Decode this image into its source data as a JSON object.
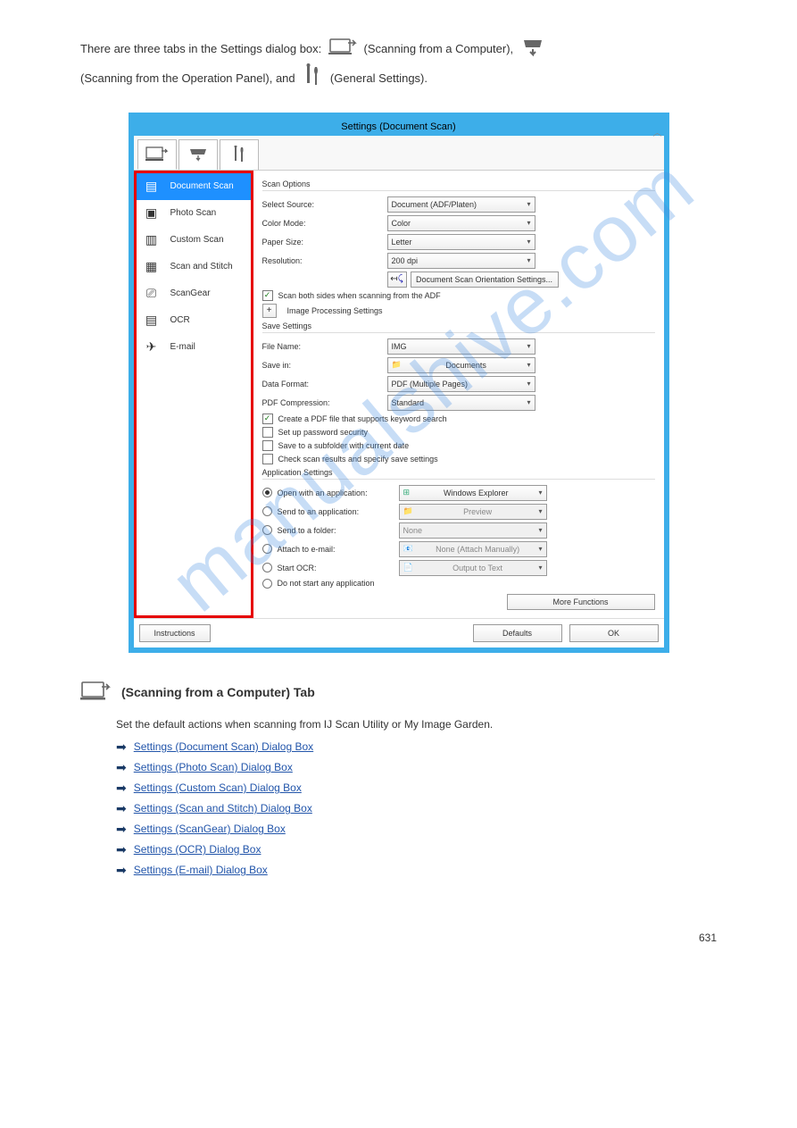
{
  "intro": {
    "line1_a": "There are three tabs in the Settings dialog box:",
    "line1_b": "(Scanning from a Computer),",
    "line1_c": "(Scanning from the Operation Panel), and",
    "line1_d": "(General Settings)."
  },
  "dialog": {
    "title": "Settings (Document Scan)"
  },
  "sidebar": {
    "items": [
      {
        "label": "Document Scan"
      },
      {
        "label": "Photo Scan"
      },
      {
        "label": "Custom Scan"
      },
      {
        "label": "Scan and Stitch"
      },
      {
        "label": "ScanGear"
      },
      {
        "label": "OCR"
      },
      {
        "label": "E-mail"
      }
    ]
  },
  "scan_options": {
    "title": "Scan Options",
    "source_label": "Select Source:",
    "source_value": "Document (ADF/Platen)",
    "color_label": "Color Mode:",
    "color_value": "Color",
    "paper_label": "Paper Size:",
    "paper_value": "Letter",
    "res_label": "Resolution:",
    "res_value": "200 dpi",
    "orient_button": "Document Scan Orientation Settings...",
    "both_sides": "Scan both sides when scanning from the ADF",
    "img_proc": "Image Processing Settings"
  },
  "save_settings": {
    "title": "Save Settings",
    "filename_label": "File Name:",
    "filename_value": "IMG",
    "savein_label": "Save in:",
    "savein_value": "Documents",
    "format_label": "Data Format:",
    "format_value": "PDF (Multiple Pages)",
    "comp_label": "PDF Compression:",
    "comp_value": "Standard",
    "keyword_search": "Create a PDF file that supports keyword search",
    "password": "Set up password security",
    "subfolder": "Save to a subfolder with current date",
    "check_results": "Check scan results and specify save settings"
  },
  "app_settings": {
    "title": "Application Settings",
    "open_label": "Open with an application:",
    "open_value": "Windows Explorer",
    "send_app_label": "Send to an application:",
    "send_app_value": "Preview",
    "send_folder_label": "Send to a folder:",
    "send_folder_value": "None",
    "attach_label": "Attach to e-mail:",
    "attach_value": "None (Attach Manually)",
    "ocr_label": "Start OCR:",
    "ocr_value": "Output to Text",
    "no_start": "Do not start any application",
    "more_functions": "More Functions"
  },
  "footer": {
    "instructions": "Instructions",
    "defaults": "Defaults",
    "ok": "OK"
  },
  "below": {
    "heading": "(Scanning from a Computer) Tab",
    "desc": "Set the default actions when scanning from IJ Scan Utility or My Image Garden.",
    "links": [
      "Settings (Document Scan) Dialog Box",
      "Settings (Photo Scan) Dialog Box",
      "Settings (Custom Scan) Dialog Box",
      "Settings (Scan and Stitch) Dialog Box",
      "Settings (ScanGear) Dialog Box",
      "Settings (OCR) Dialog Box",
      "Settings (E-mail) Dialog Box"
    ]
  },
  "page_number": "631"
}
